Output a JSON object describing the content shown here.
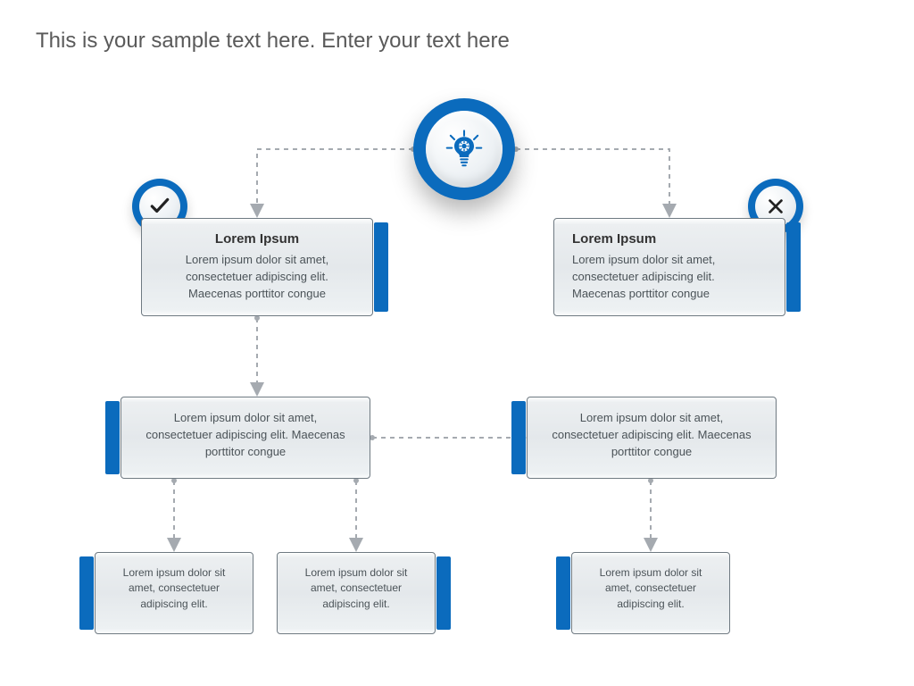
{
  "title": "This is your sample text here. Enter your text here",
  "colors": {
    "accent": "#0b6bbd",
    "connector": "#a5aab0"
  },
  "center": {
    "icon": "lightbulb-gear-icon"
  },
  "branches": {
    "yes": {
      "badge": "check-icon",
      "box": {
        "title": "Lorem Ipsum",
        "body": "Lorem ipsum dolor sit amet, consectetuer adipiscing elit. Maecenas porttitor congue"
      }
    },
    "no": {
      "badge": "cross-icon",
      "box": {
        "title": "Lorem Ipsum",
        "body": "Lorem ipsum dolor sit amet, consectetuer adipiscing elit. Maecenas porttitor congue"
      }
    }
  },
  "row2": {
    "left": {
      "body": "Lorem ipsum dolor sit amet, consectetuer adipiscing elit. Maecenas porttitor congue"
    },
    "right": {
      "body": "Lorem ipsum dolor sit amet, consectetuer adipiscing elit. Maecenas porttitor congue"
    }
  },
  "leaves": {
    "l1": {
      "body": "Lorem ipsum dolor sit amet, consectetuer adipiscing elit."
    },
    "l2": {
      "body": "Lorem ipsum dolor sit amet, consectetuer adipiscing elit."
    },
    "l3": {
      "body": "Lorem ipsum dolor sit amet, consectetuer adipiscing elit."
    }
  }
}
